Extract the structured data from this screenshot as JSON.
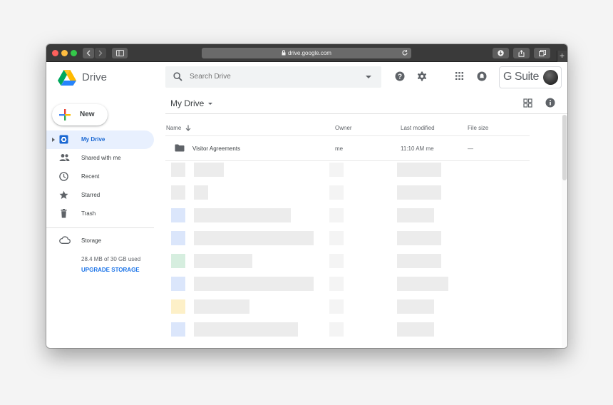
{
  "browser": {
    "url": "drive.google.com"
  },
  "app": {
    "name": "Drive",
    "suite_label": "G Suite"
  },
  "search": {
    "placeholder": "Search Drive"
  },
  "new_button": {
    "label": "New"
  },
  "nav": {
    "items": [
      {
        "label": "My Drive",
        "icon": "my-drive-icon",
        "active": true
      },
      {
        "label": "Shared with me",
        "icon": "people-icon",
        "active": false
      },
      {
        "label": "Recent",
        "icon": "clock-icon",
        "active": false
      },
      {
        "label": "Starred",
        "icon": "star-icon",
        "active": false
      },
      {
        "label": "Trash",
        "icon": "trash-icon",
        "active": false
      }
    ],
    "storage": {
      "label": "Storage",
      "used_text": "28.4 MB of 30 GB used",
      "upgrade_label": "UPGRADE STORAGE"
    }
  },
  "main": {
    "title": "My Drive",
    "columns": {
      "name": "Name",
      "owner": "Owner",
      "modified": "Last modified",
      "size": "File size"
    },
    "rows": [
      {
        "name": "Visitor Agreements",
        "owner": "me",
        "modified": "11:10 AM me",
        "size": "—",
        "icon": "folder-icon"
      }
    ]
  },
  "colors": {
    "accent": "#1a73e8",
    "active_bg": "#e8f0fe",
    "active_text": "#1967d2"
  }
}
